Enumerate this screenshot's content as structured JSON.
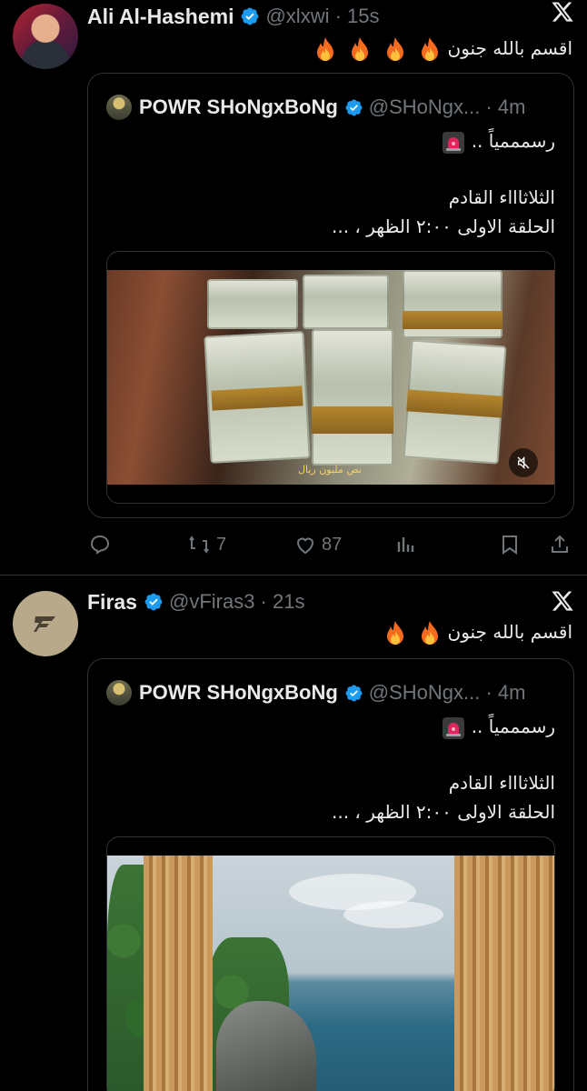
{
  "tweets": [
    {
      "author_name": "Ali Al-Hashemi",
      "handle_time": "@xlxwi · 15s",
      "text": "اقسم بالله جنون",
      "fire_count": 4,
      "quote": {
        "name": "POWR SHoNgxBoNg",
        "handle_time": "@SHoNgx... · 4m",
        "line1": "رسمممياً ..",
        "line2": "الثلاثاااء القادم",
        "line3": "الحلقة الاولى ٢:٠٠ الظهر ، ...",
        "media_caption": "نص مليون ريال"
      },
      "actions": {
        "reply": "",
        "retweet": "7",
        "like": "87"
      }
    },
    {
      "author_name": "Firas",
      "handle_time": "@vFiras3 · 21s",
      "text": "اقسم بالله جنون",
      "fire_count": 2,
      "quote": {
        "name": "POWR SHoNgxBoNg",
        "handle_time": "@SHoNgx... · 4m",
        "line1": "رسمممياً ..",
        "line2": "الثلاثاااء القادم",
        "line3": "الحلقة الاولى ٢:٠٠ الظهر ، ..."
      }
    }
  ],
  "colors": {
    "background": "#000000",
    "text": "#e7e9ea",
    "muted": "#71767b",
    "verified": "#1d9bf0",
    "border": "#2f3336"
  }
}
